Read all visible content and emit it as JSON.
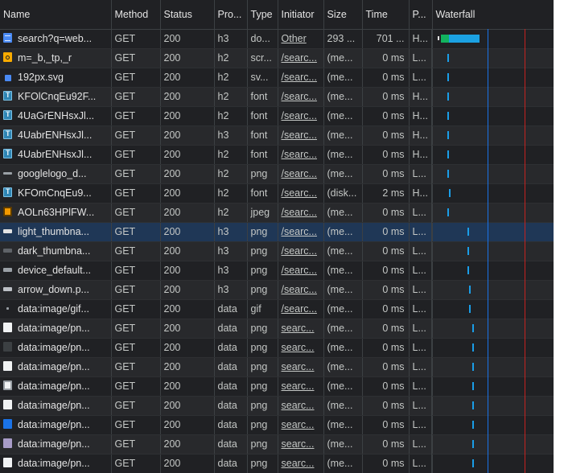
{
  "columns": [
    "Name",
    "Method",
    "Status",
    "Pro...",
    "Type",
    "Initiator",
    "Size",
    "Time",
    "P...",
    "Waterfall"
  ],
  "rows": [
    {
      "name": "search?q=web...",
      "method": "GET",
      "status": "200",
      "protocol": "h3",
      "type": "do...",
      "initiator": "Other",
      "size": "293 ...",
      "time": "701 ...",
      "priority": "H...",
      "icon": "document-icon"
    },
    {
      "name": "m=_b,_tp,_r",
      "method": "GET",
      "status": "200",
      "protocol": "h2",
      "type": "scr...",
      "initiator": "/searc...",
      "size": "(me...",
      "time": "0 ms",
      "priority": "L...",
      "icon": "script-icon"
    },
    {
      "name": "192px.svg",
      "method": "GET",
      "status": "200",
      "protocol": "h2",
      "type": "sv...",
      "initiator": "/searc...",
      "size": "(me...",
      "time": "0 ms",
      "priority": "L...",
      "icon": "svg-image-icon"
    },
    {
      "name": "KFOlCnqEu92F...",
      "method": "GET",
      "status": "200",
      "protocol": "h2",
      "type": "font",
      "initiator": "/searc...",
      "size": "(me...",
      "time": "0 ms",
      "priority": "H...",
      "icon": "font-icon"
    },
    {
      "name": "4UaGrENHsxJl...",
      "method": "GET",
      "status": "200",
      "protocol": "h2",
      "type": "font",
      "initiator": "/searc...",
      "size": "(me...",
      "time": "0 ms",
      "priority": "H...",
      "icon": "font-icon"
    },
    {
      "name": "4UabrENHsxJl...",
      "method": "GET",
      "status": "200",
      "protocol": "h3",
      "type": "font",
      "initiator": "/searc...",
      "size": "(me...",
      "time": "0 ms",
      "priority": "H...",
      "icon": "font-icon"
    },
    {
      "name": "4UabrENHsxJl...",
      "method": "GET",
      "status": "200",
      "protocol": "h2",
      "type": "font",
      "initiator": "/searc...",
      "size": "(me...",
      "time": "0 ms",
      "priority": "H...",
      "icon": "font-icon"
    },
    {
      "name": "googlelogo_d...",
      "method": "GET",
      "status": "200",
      "protocol": "h2",
      "type": "png",
      "initiator": "/searc...",
      "size": "(me...",
      "time": "0 ms",
      "priority": "L...",
      "icon": "logo-image-icon"
    },
    {
      "name": "KFOmCnqEu9...",
      "method": "GET",
      "status": "200",
      "protocol": "h2",
      "type": "font",
      "initiator": "/searc...",
      "size": "(disk...",
      "time": "2 ms",
      "priority": "H...",
      "icon": "font-icon"
    },
    {
      "name": "AOLn63HPlFW...",
      "method": "GET",
      "status": "200",
      "protocol": "h2",
      "type": "jpeg",
      "initiator": "/searc...",
      "size": "(me...",
      "time": "0 ms",
      "priority": "L...",
      "icon": "jpeg-image-icon"
    },
    {
      "name": "light_thumbna...",
      "method": "GET",
      "status": "200",
      "protocol": "h3",
      "type": "png",
      "initiator": "/searc...",
      "size": "(me...",
      "time": "0 ms",
      "priority": "L...",
      "icon": "thumbnail-light-icon"
    },
    {
      "name": "dark_thumbna...",
      "method": "GET",
      "status": "200",
      "protocol": "h3",
      "type": "png",
      "initiator": "/searc...",
      "size": "(me...",
      "time": "0 ms",
      "priority": "L...",
      "icon": "thumbnail-dark-icon"
    },
    {
      "name": "device_default...",
      "method": "GET",
      "status": "200",
      "protocol": "h3",
      "type": "png",
      "initiator": "/searc...",
      "size": "(me...",
      "time": "0 ms",
      "priority": "L...",
      "icon": "device-image-icon"
    },
    {
      "name": "arrow_down.p...",
      "method": "GET",
      "status": "200",
      "protocol": "h3",
      "type": "png",
      "initiator": "/searc...",
      "size": "(me...",
      "time": "0 ms",
      "priority": "L...",
      "icon": "arrow-image-icon"
    },
    {
      "name": "data:image/gif...",
      "method": "GET",
      "status": "200",
      "protocol": "data",
      "type": "gif",
      "initiator": "/searc...",
      "size": "(me...",
      "time": "0 ms",
      "priority": "L...",
      "icon": "gif-dot-icon"
    },
    {
      "name": "data:image/pn...",
      "method": "GET",
      "status": "200",
      "protocol": "data",
      "type": "png",
      "initiator": "searc...",
      "size": "(me...",
      "time": "0 ms",
      "priority": "L...",
      "icon": "white-image-icon"
    },
    {
      "name": "data:image/pn...",
      "method": "GET",
      "status": "200",
      "protocol": "data",
      "type": "png",
      "initiator": "searc...",
      "size": "(me...",
      "time": "0 ms",
      "priority": "L...",
      "icon": "black-image-icon"
    },
    {
      "name": "data:image/pn...",
      "method": "GET",
      "status": "200",
      "protocol": "data",
      "type": "png",
      "initiator": "searc...",
      "size": "(me...",
      "time": "0 ms",
      "priority": "L...",
      "icon": "white-image-icon"
    },
    {
      "name": "data:image/pn...",
      "method": "GET",
      "status": "200",
      "protocol": "data",
      "type": "png",
      "initiator": "searc...",
      "size": "(me...",
      "time": "0 ms",
      "priority": "L...",
      "icon": "mixed-image-icon"
    },
    {
      "name": "data:image/pn...",
      "method": "GET",
      "status": "200",
      "protocol": "data",
      "type": "png",
      "initiator": "searc...",
      "size": "(me...",
      "time": "0 ms",
      "priority": "L...",
      "icon": "white-image-icon"
    },
    {
      "name": "data:image/pn...",
      "method": "GET",
      "status": "200",
      "protocol": "data",
      "type": "png",
      "initiator": "searc...",
      "size": "(me...",
      "time": "0 ms",
      "priority": "L...",
      "icon": "blue-image-icon"
    },
    {
      "name": "data:image/pn...",
      "method": "GET",
      "status": "200",
      "protocol": "data",
      "type": "png",
      "initiator": "searc...",
      "size": "(me...",
      "time": "0 ms",
      "priority": "L...",
      "icon": "purple-image-icon"
    },
    {
      "name": "data:image/pn...",
      "method": "GET",
      "status": "200",
      "protocol": "data",
      "type": "png",
      "initiator": "searc...",
      "size": "(me...",
      "time": "0 ms",
      "priority": "L...",
      "icon": "white-image-icon"
    }
  ],
  "selected_row": 10,
  "colors": {
    "panel_bg": "#202124",
    "selected_row": "#1f3756",
    "dom_content_loaded_line": "#1a73e8",
    "load_line": "#c5221f",
    "waterfall_bar": "#1a9ee8",
    "waiting_bar": "#12b35f"
  }
}
